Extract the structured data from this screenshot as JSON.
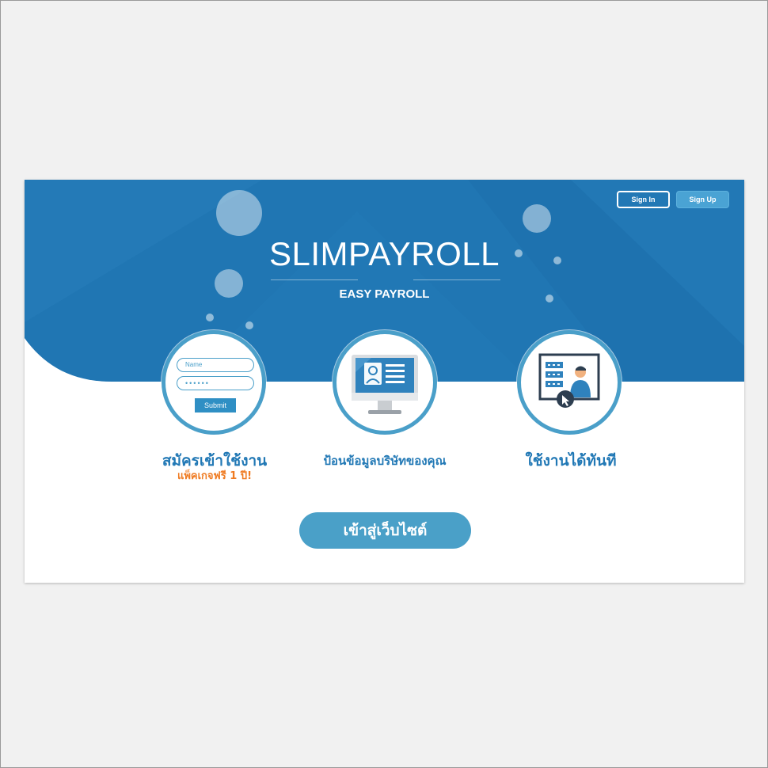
{
  "nav": {
    "sign_in": "Sign In",
    "sign_up": "Sign Up"
  },
  "brand": {
    "title": "SLIMPAYROLL",
    "tagline": "EASY PAYROLL"
  },
  "steps": [
    {
      "label": "สมัครเข้าใช้งาน",
      "promo": "แพ็คเกจฟรี 1 ปี!",
      "icon": "signup-form-icon",
      "form": {
        "name_placeholder": "Name",
        "password_mask": "••••••",
        "submit_label": "Submit"
      }
    },
    {
      "label": "ป้อนข้อมูลบริษัทของคุณ",
      "icon": "monitor-profile-icon"
    },
    {
      "label": "ใช้งานได้ทันที",
      "icon": "presentation-user-icon"
    }
  ],
  "cta": {
    "label": "เข้าสู่เว็บไซต์"
  },
  "colors": {
    "hero": "#2076b3",
    "accent": "#4a9fc9",
    "label": "#2178b5",
    "promo": "#ef7b22",
    "cta": "#4aa0c8"
  }
}
